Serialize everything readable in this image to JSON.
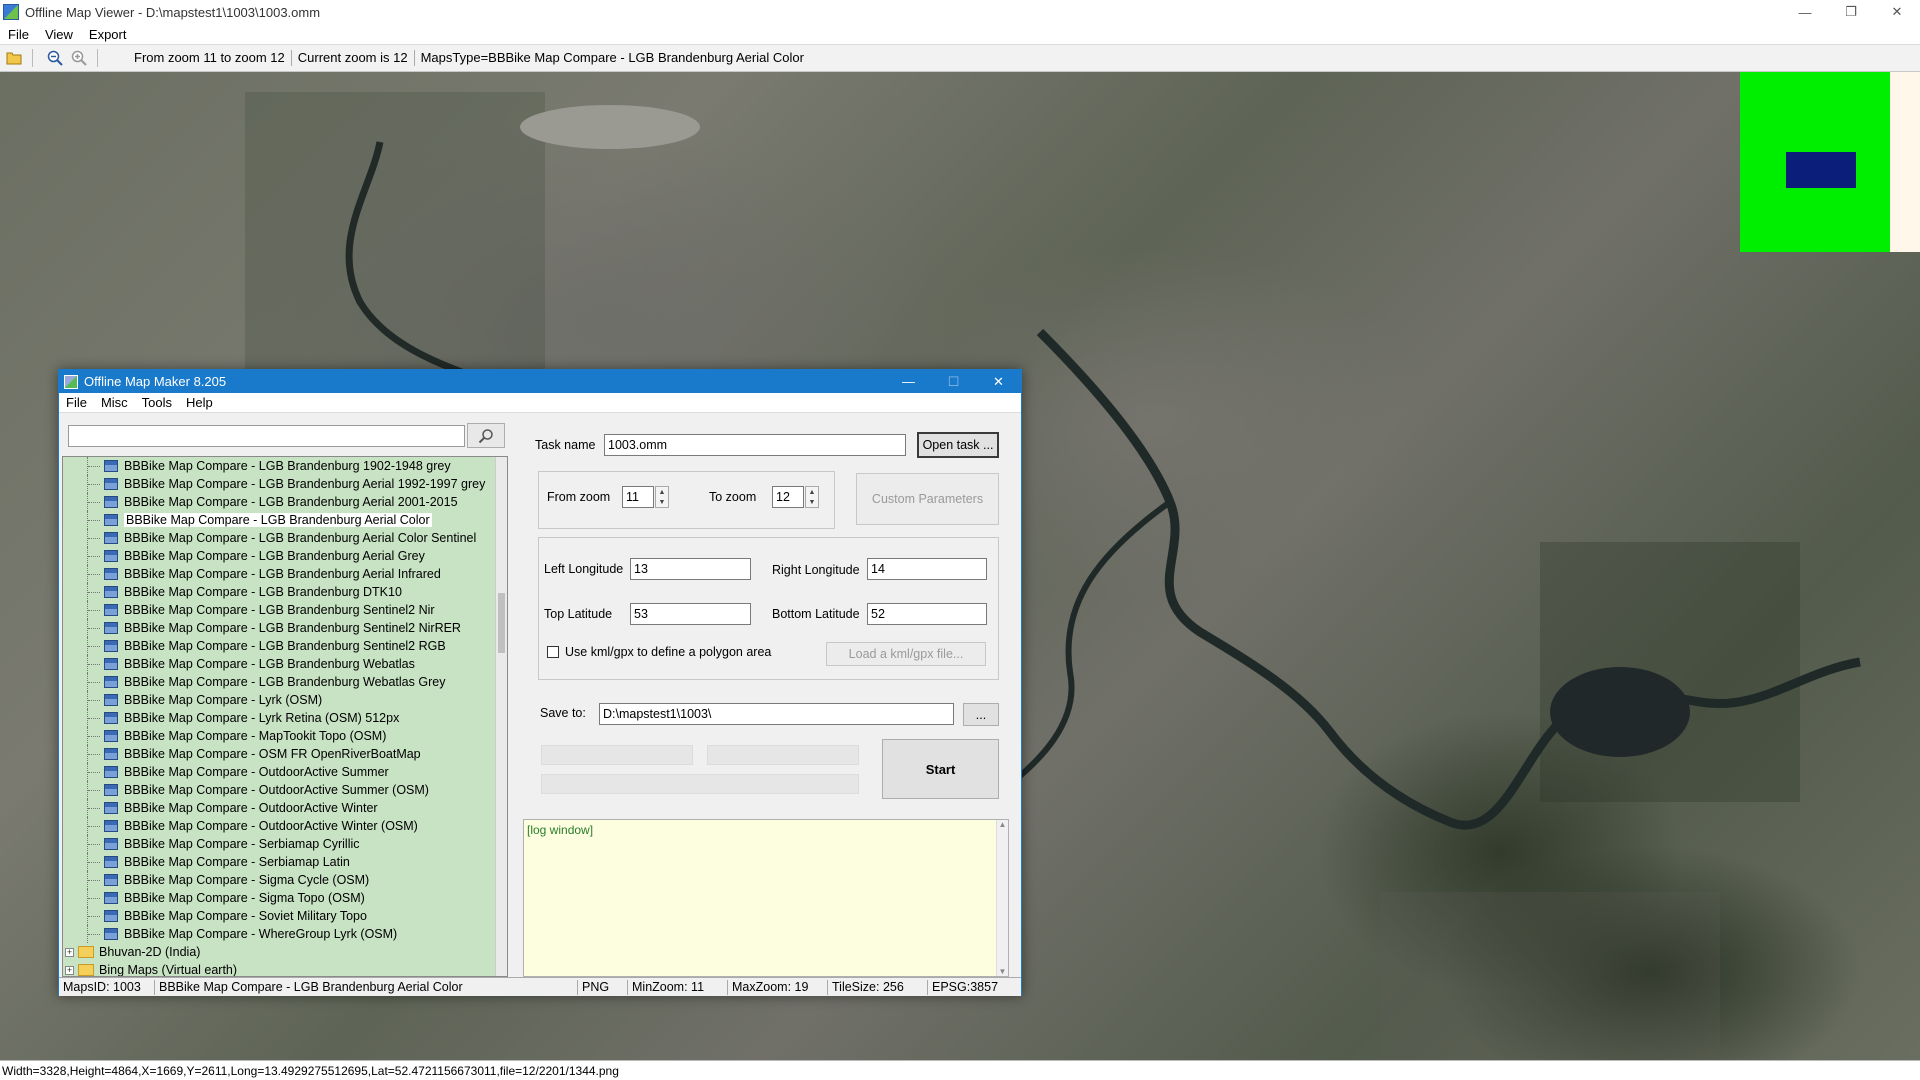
{
  "window": {
    "title": "Offline Map Viewer - D:\\mapstest1\\1003\\1003.omm",
    "minimize": "—",
    "restore": "❐",
    "close": "✕"
  },
  "menu": [
    "File",
    "View",
    "Export"
  ],
  "toolbar": {
    "zoom_range": "From zoom 11 to zoom 12",
    "current_zoom": "Current zoom is 12",
    "maps_type": "MapsType=BBBike Map Compare - LGB Brandenburg Aerial Color",
    "icons": [
      "open-folder-icon",
      "zoom-out-icon",
      "zoom-in-icon"
    ]
  },
  "overview_colors": {
    "bg": "#00ee00",
    "rect": "#0a1e7a",
    "margin": "#fff8ea"
  },
  "coord_status": "Width=3328,Height=4864,X=1669,Y=2611,Long=13.4929275512695,Lat=52.4721156673011,file=12/2201/1344.png",
  "dialog": {
    "title": "Offline Map Maker 8.205",
    "minimize": "—",
    "maximize": "☐",
    "close": "✕",
    "menu": [
      "File",
      "Misc",
      "Tools",
      "Help"
    ],
    "search_value": "",
    "tree_items": [
      "BBBike Map Compare - LGB Brandenburg 1902-1948 grey",
      "BBBike Map Compare - LGB Brandenburg Aerial 1992-1997 grey",
      "BBBike Map Compare - LGB Brandenburg Aerial 2001-2015",
      "BBBike Map Compare - LGB Brandenburg Aerial Color",
      "BBBike Map Compare - LGB Brandenburg Aerial Color Sentinel",
      "BBBike Map Compare - LGB Brandenburg Aerial Grey",
      "BBBike Map Compare - LGB Brandenburg Aerial Infrared",
      "BBBike Map Compare - LGB Brandenburg DTK10",
      "BBBike Map Compare - LGB Brandenburg Sentinel2 Nir",
      "BBBike Map Compare - LGB Brandenburg Sentinel2 NirRER",
      "BBBike Map Compare - LGB Brandenburg Sentinel2 RGB",
      "BBBike Map Compare - LGB Brandenburg Webatlas",
      "BBBike Map Compare - LGB Brandenburg Webatlas Grey",
      "BBBike Map Compare - Lyrk (OSM)",
      "BBBike Map Compare - Lyrk Retina (OSM) 512px",
      "BBBike Map Compare - MapTookit Topo (OSM)",
      "BBBike Map Compare - OSM FR OpenRiverBoatMap",
      "BBBike Map Compare - OutdoorActive Summer",
      "BBBike Map Compare - OutdoorActive Summer (OSM)",
      "BBBike Map Compare - OutdoorActive Winter",
      "BBBike Map Compare - OutdoorActive Winter (OSM)",
      "BBBike Map Compare - Serbiamap Cyrillic",
      "BBBike Map Compare - Serbiamap Latin",
      "BBBike Map Compare - Sigma Cycle (OSM)",
      "BBBike Map Compare - Sigma Topo (OSM)",
      "BBBike Map Compare - Soviet Military Topo",
      "BBBike Map Compare - WhereGroup Lyrk (OSM)"
    ],
    "tree_folders": [
      "Bhuvan-2D (India)",
      "Bing Maps (Virtual earth)"
    ],
    "selected_index": 3,
    "task_name_label": "Task name",
    "task_name_value": "1003.omm",
    "open_task": "Open task ...",
    "from_zoom_label": "From zoom",
    "from_zoom_value": "11",
    "to_zoom_label": "To zoom",
    "to_zoom_value": "12",
    "custom_params": "Custom Parameters",
    "left_lon_label": "Left Longitude",
    "left_lon_value": "13",
    "right_lon_label": "Right Longitude",
    "right_lon_value": "14",
    "top_lat_label": "Top Latitude",
    "top_lat_value": "53",
    "bottom_lat_label": "Bottom Latitude",
    "bottom_lat_value": "52",
    "kml_checkbox_label": "Use kml/gpx to define a polygon area",
    "load_kml": "Load a kml/gpx file...",
    "save_to_label": "Save to:",
    "save_to_value": "D:\\mapstest1\\1003\\",
    "browse": "...",
    "start": "Start",
    "log_text": "[log window]",
    "status": {
      "maps_id": "MapsID: 1003",
      "maps_name": "BBBike Map Compare - LGB Brandenburg Aerial Color",
      "format": "PNG",
      "min_zoom": "MinZoom: 11",
      "max_zoom": "MaxZoom: 19",
      "tile_size": "TileSize: 256",
      "epsg": "EPSG:3857"
    }
  }
}
